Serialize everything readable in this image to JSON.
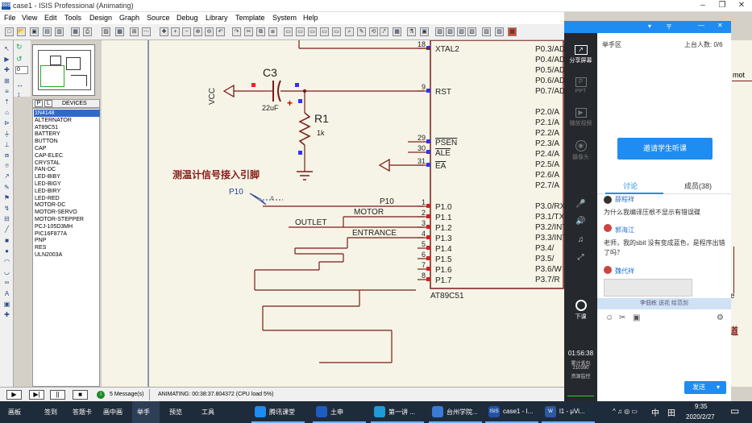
{
  "window": {
    "title": "case1 - ISIS Professional (Animating)",
    "logo_text": "ISIS"
  },
  "menu": [
    "File",
    "View",
    "Edit",
    "Tools",
    "Design",
    "Graph",
    "Source",
    "Debug",
    "Library",
    "Template",
    "System",
    "Help"
  ],
  "sidebar": {
    "tabs": {
      "p": "P",
      "l": "L",
      "title": "DEVICES"
    },
    "devices": [
      "1N4148",
      "ALTERNATOR",
      "AT89C51",
      "BATTERY",
      "BUTTON",
      "CAP",
      "CAP-ELEC",
      "CRYSTAL",
      "FAN-DC",
      "LED-BIBY",
      "LED-BIGY",
      "LED-BIRY",
      "LED-RED",
      "MOTOR-DC",
      "MOTOR-SERVO",
      "MOTOR-STEPPER",
      "PCJ-105D3MH",
      "PIC16F877A",
      "PNP",
      "RES",
      "ULN2003A"
    ],
    "selected": "1N4148",
    "rotation_value": "0"
  },
  "schematic": {
    "mcu_name": "AT89C51",
    "left_pins": [
      {
        "num": "18",
        "name": "XTAL2"
      },
      {
        "num": "9",
        "name": "RST"
      },
      {
        "num": "29",
        "name": "PSEN"
      },
      {
        "num": "30",
        "name": "ALE"
      },
      {
        "num": "31",
        "name": "EA"
      },
      {
        "num": "1",
        "name": "P1.0"
      },
      {
        "num": "2",
        "name": "P1.1"
      },
      {
        "num": "3",
        "name": "P1.2"
      },
      {
        "num": "4",
        "name": "P1.3"
      },
      {
        "num": "5",
        "name": "P1.4"
      },
      {
        "num": "6",
        "name": "P1.5"
      },
      {
        "num": "7",
        "name": "P1.6"
      },
      {
        "num": "8",
        "name": "P1.7"
      }
    ],
    "right_pins": [
      "P0.3/AD",
      "P0.4/AD",
      "P0.5/AD",
      "P0.6/AD",
      "P0.7/AD",
      "P2.0/A",
      "P2.1/A",
      "P2.2/A",
      "P2.3/A",
      "P2.4/A",
      "P2.5/A",
      "P2.6/A",
      "P2.7/A",
      "P3.0/RX",
      "P3.1/TX",
      "P3.2/INT",
      "P3.3/INT",
      "P3.4/",
      "P3.5/",
      "P3.6/W",
      "P3.7/R"
    ],
    "cap_name": "C3",
    "cap_value": "22uF",
    "res_name": "R1",
    "res_value": "1k",
    "vcc_label": "VCC",
    "annotation": "测温计信号接入引脚",
    "probe_label": "P10",
    "nets": {
      "p10": "P10",
      "motor": "MOTOR",
      "outlet": "OUTLET",
      "entrance": "ENTRANCE"
    },
    "right_frag": {
      "mot": "mot",
      "e": "e",
      "dao": "道"
    }
  },
  "status": {
    "messages": "5 Message(s)",
    "animating": "ANIMATING: 00:38:37.804372 (CPU load 5%)"
  },
  "tencent": {
    "title_bar": {
      "menu": "▾",
      "pin": "〒",
      "min": "—",
      "close": "✕"
    },
    "raise_hand": "举手区",
    "online": "上台人数: 0/6",
    "side": [
      "分享屏幕",
      "PPT",
      "播放视频",
      "摄像头"
    ],
    "end_class": "下课",
    "time": "01:56:38",
    "stats": [
      "累计丢包",
      "210390",
      "资源监控"
    ],
    "invite": "邀请学生听课",
    "tabs": {
      "discuss": "讨论",
      "members": "成员(38)"
    },
    "messages": [
      {
        "user": "薛程祥",
        "text": "为什么我编译压根不显示有错误碟"
      },
      {
        "user": "郭海江",
        "text": "老师，我的sbit 没有变成蓝色，是程序出错了吗？"
      },
      {
        "user": "魏代祥",
        "text": ""
      }
    ],
    "hint": "李佃栋 送花 给范剑",
    "send": "发送",
    "send_arrow": "▾"
  },
  "taskbar": {
    "items": [
      "画板",
      "签到",
      "答题卡",
      "画中画",
      "举手",
      "预览",
      "工具"
    ],
    "apps": [
      "腾讯课堂",
      "土申",
      "第一讲 ...",
      "台州学院...",
      "case1 - I...",
      "l1 - μVi..."
    ],
    "app_logos": {
      "isis": "ISIS",
      "uvision": "W"
    },
    "tray_icons": "^ ♫ ◎ ▭",
    "ime": "中",
    "ime_mode": "田",
    "time": "9:35",
    "date": "2020/2/27"
  }
}
